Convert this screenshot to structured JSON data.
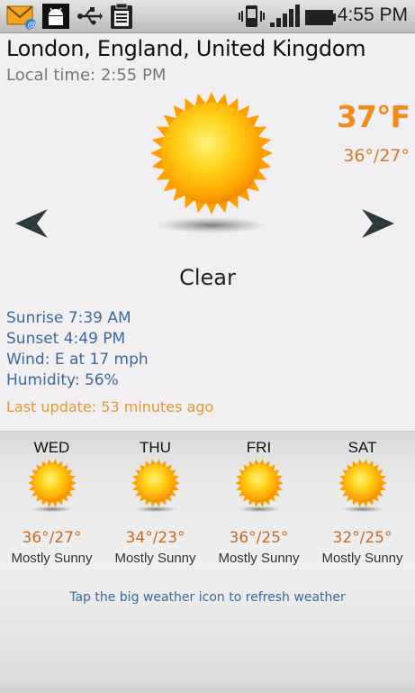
{
  "status_bar": {
    "time": "4:55 PM",
    "left_icons": [
      "mail-notification-icon",
      "android-debug-icon",
      "usb-icon",
      "clipboard-icon"
    ],
    "right_icons": [
      "vibrate-phone-icon",
      "signal-strength-icon",
      "battery-icon"
    ]
  },
  "current": {
    "location": "London, England, United Kingdom",
    "local_time": "Local time: 2:55 PM",
    "temperature": "37°F",
    "hi_lo": "36°/27°",
    "condition": "Clear",
    "sunrise": "Sunrise 7:39 AM",
    "sunset": "Sunset 4:49 PM",
    "wind": "Wind: E at 17 mph",
    "humidity": "Humidity: 56%",
    "last_update": "Last update: 53 minutes ago"
  },
  "forecast": [
    {
      "day": "WED",
      "hi_lo": "36°/27°",
      "condition": "Mostly Sunny"
    },
    {
      "day": "THU",
      "hi_lo": "34°/23°",
      "condition": "Mostly Sunny"
    },
    {
      "day": "FRI",
      "hi_lo": "36°/25°",
      "condition": "Mostly Sunny"
    },
    {
      "day": "SAT",
      "hi_lo": "32°/25°",
      "condition": "Mostly Sunny"
    }
  ],
  "hint": "Tap the big weather icon to refresh weather",
  "colors": {
    "temperature": "#f28a1c",
    "details_text": "#3d6a9a",
    "last_update": "#e19a2b",
    "sun_core": "#ffb400"
  }
}
